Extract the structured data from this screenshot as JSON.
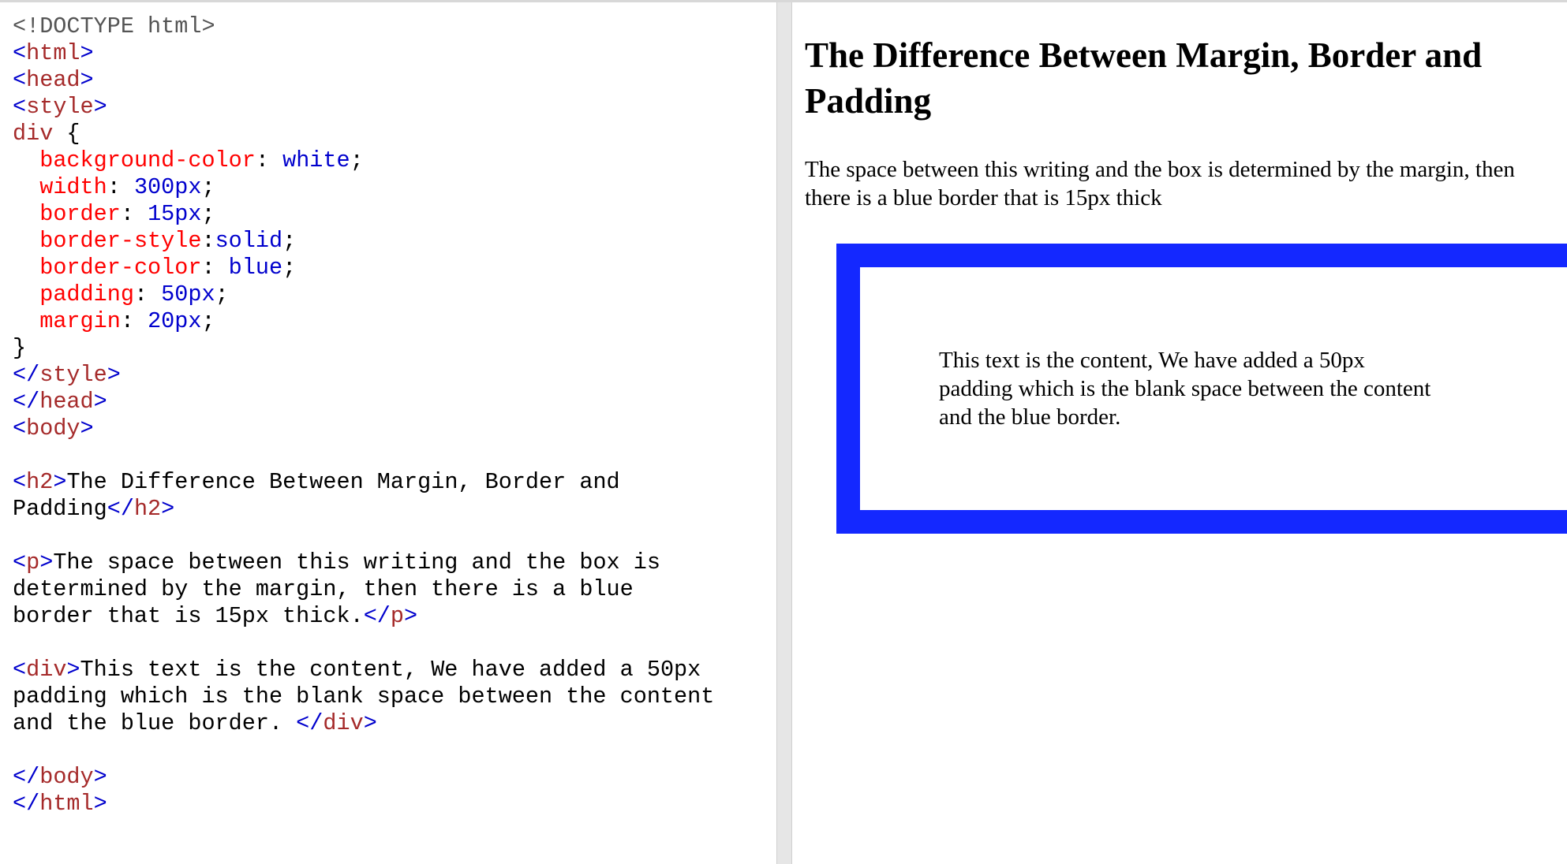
{
  "code_editor": {
    "lines": [
      [
        {
          "t": "<!DOCTYPE html>",
          "c": "doc"
        }
      ],
      [
        {
          "t": "<",
          "c": "br"
        },
        {
          "t": "html",
          "c": "tag"
        },
        {
          "t": ">",
          "c": "br"
        }
      ],
      [
        {
          "t": "<",
          "c": "br"
        },
        {
          "t": "head",
          "c": "tag"
        },
        {
          "t": ">",
          "c": "br"
        }
      ],
      [
        {
          "t": "<",
          "c": "br"
        },
        {
          "t": "style",
          "c": "tag"
        },
        {
          "t": ">",
          "c": "br"
        }
      ],
      [
        {
          "t": "div",
          "c": "tag"
        },
        {
          "t": " {",
          "c": "txt"
        }
      ],
      [
        {
          "t": "  ",
          "c": "txt"
        },
        {
          "t": "background-color",
          "c": "prop"
        },
        {
          "t": ": ",
          "c": "txt"
        },
        {
          "t": "white",
          "c": "val"
        },
        {
          "t": ";",
          "c": "txt"
        }
      ],
      [
        {
          "t": "  ",
          "c": "txt"
        },
        {
          "t": "width",
          "c": "prop"
        },
        {
          "t": ": ",
          "c": "txt"
        },
        {
          "t": "300px",
          "c": "val"
        },
        {
          "t": ";",
          "c": "txt"
        }
      ],
      [
        {
          "t": "  ",
          "c": "txt"
        },
        {
          "t": "border",
          "c": "prop"
        },
        {
          "t": ": ",
          "c": "txt"
        },
        {
          "t": "15px",
          "c": "val"
        },
        {
          "t": ";",
          "c": "txt"
        }
      ],
      [
        {
          "t": "  ",
          "c": "txt"
        },
        {
          "t": "border-style",
          "c": "prop"
        },
        {
          "t": ":",
          "c": "txt"
        },
        {
          "t": "solid",
          "c": "val"
        },
        {
          "t": ";",
          "c": "txt"
        }
      ],
      [
        {
          "t": "  ",
          "c": "txt"
        },
        {
          "t": "border-color",
          "c": "prop"
        },
        {
          "t": ": ",
          "c": "txt"
        },
        {
          "t": "blue",
          "c": "val"
        },
        {
          "t": ";",
          "c": "txt"
        }
      ],
      [
        {
          "t": "  ",
          "c": "txt"
        },
        {
          "t": "padding",
          "c": "prop"
        },
        {
          "t": ": ",
          "c": "txt"
        },
        {
          "t": "50px",
          "c": "val"
        },
        {
          "t": ";",
          "c": "txt"
        }
      ],
      [
        {
          "t": "  ",
          "c": "txt"
        },
        {
          "t": "margin",
          "c": "prop"
        },
        {
          "t": ": ",
          "c": "txt"
        },
        {
          "t": "20px",
          "c": "val"
        },
        {
          "t": ";",
          "c": "txt"
        }
      ],
      [
        {
          "t": "}",
          "c": "txt"
        }
      ],
      [
        {
          "t": "</",
          "c": "br"
        },
        {
          "t": "style",
          "c": "tag"
        },
        {
          "t": ">",
          "c": "br"
        }
      ],
      [
        {
          "t": "</",
          "c": "br"
        },
        {
          "t": "head",
          "c": "tag"
        },
        {
          "t": ">",
          "c": "br"
        }
      ],
      [
        {
          "t": "<",
          "c": "br"
        },
        {
          "t": "body",
          "c": "tag"
        },
        {
          "t": ">",
          "c": "br"
        }
      ],
      [],
      [
        {
          "t": "<",
          "c": "br"
        },
        {
          "t": "h2",
          "c": "tag"
        },
        {
          "t": ">",
          "c": "br"
        },
        {
          "t": "The Difference Between Margin, Border and",
          "c": "txt"
        }
      ],
      [
        {
          "t": "Padding",
          "c": "txt"
        },
        {
          "t": "</",
          "c": "br"
        },
        {
          "t": "h2",
          "c": "tag"
        },
        {
          "t": ">",
          "c": "br"
        }
      ],
      [],
      [
        {
          "t": "<",
          "c": "br"
        },
        {
          "t": "p",
          "c": "tag"
        },
        {
          "t": ">",
          "c": "br"
        },
        {
          "t": "The space between this writing and the box is",
          "c": "txt"
        }
      ],
      [
        {
          "t": "determined by the margin, then there is a blue",
          "c": "txt"
        }
      ],
      [
        {
          "t": "border that is 15px thick.",
          "c": "txt"
        },
        {
          "t": "</",
          "c": "br"
        },
        {
          "t": "p",
          "c": "tag"
        },
        {
          "t": ">",
          "c": "br"
        }
      ],
      [],
      [
        {
          "t": "<",
          "c": "br"
        },
        {
          "t": "div",
          "c": "tag"
        },
        {
          "t": ">",
          "c": "br"
        },
        {
          "t": "This text is the content, We have added a 50px",
          "c": "txt"
        }
      ],
      [
        {
          "t": "padding which is the blank space between the content",
          "c": "txt"
        }
      ],
      [
        {
          "t": "and the blue border. ",
          "c": "txt"
        },
        {
          "t": "</",
          "c": "br"
        },
        {
          "t": "div",
          "c": "tag"
        },
        {
          "t": ">",
          "c": "br"
        }
      ],
      [],
      [
        {
          "t": "</",
          "c": "br"
        },
        {
          "t": "body",
          "c": "tag"
        },
        {
          "t": ">",
          "c": "br"
        }
      ],
      [
        {
          "t": "</",
          "c": "br"
        },
        {
          "t": "html",
          "c": "tag"
        },
        {
          "t": ">",
          "c": "br"
        }
      ]
    ]
  },
  "result": {
    "heading": "The Difference Between Margin, Border and Padding",
    "paragraph": "The space between this writing and the box is determined by the margin, then there is a blue border that is 15px thick",
    "box_text": "This text is the content, We have added a 50px padding which is the blank space between the content and the blue border."
  },
  "colors": {
    "tag": "#a52a2a",
    "bracket": "#0000cd",
    "property": "#ff0000",
    "value": "#0000cd",
    "doctype": "#555555",
    "box_border": "#1428ff"
  }
}
